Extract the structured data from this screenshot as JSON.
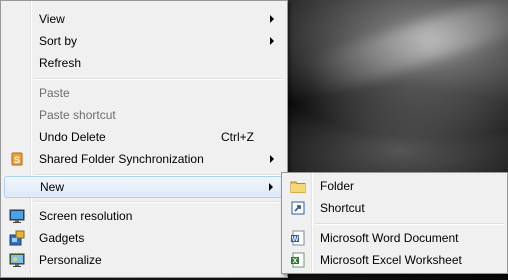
{
  "context_menu": {
    "items": [
      {
        "label": "View",
        "has_submenu": true
      },
      {
        "label": "Sort by",
        "has_submenu": true
      },
      {
        "label": "Refresh"
      },
      {
        "label": "Paste",
        "disabled": true
      },
      {
        "label": "Paste shortcut",
        "disabled": true
      },
      {
        "label": "Undo Delete",
        "shortcut": "Ctrl+Z"
      },
      {
        "label": "Shared Folder Synchronization",
        "has_submenu": true,
        "icon": "sync-icon"
      },
      {
        "label": "New",
        "has_submenu": true,
        "highlighted": true
      },
      {
        "label": "Screen resolution",
        "icon": "monitor-icon"
      },
      {
        "label": "Gadgets",
        "icon": "gadgets-icon"
      },
      {
        "label": "Personalize",
        "icon": "personalize-icon"
      }
    ]
  },
  "new_submenu": {
    "items": [
      {
        "label": "Folder",
        "icon": "folder-icon"
      },
      {
        "label": "Shortcut",
        "icon": "shortcut-icon"
      },
      {
        "label": "Microsoft Word Document",
        "icon": "word-document-icon"
      },
      {
        "label": "Microsoft Excel Worksheet",
        "icon": "excel-worksheet-icon"
      }
    ]
  },
  "colors": {
    "menu_background": "#f0f0f0",
    "highlight_border": "#aecff7",
    "disabled_text": "#6d6d6d"
  }
}
